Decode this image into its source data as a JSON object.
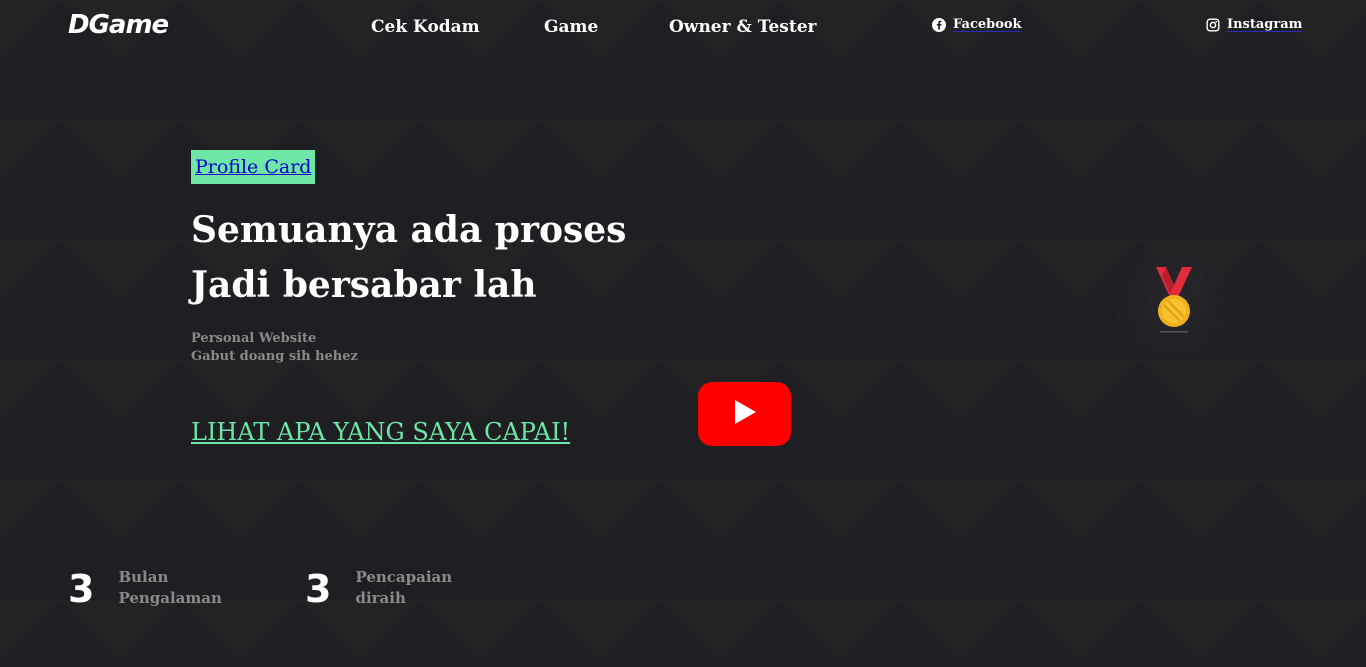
{
  "header": {
    "logo": "DGame",
    "nav": [
      {
        "label": "Cek Kodam"
      },
      {
        "label": "Game"
      },
      {
        "label": "Owner & Tester"
      }
    ],
    "social": [
      {
        "label": "Facebook",
        "icon": "facebook-icon"
      },
      {
        "label": "Instagram",
        "icon": "instagram-icon"
      }
    ]
  },
  "hero": {
    "profile_link": "Profile Card",
    "headline_line1": "Semuanya ada proses",
    "headline_line2": "Jadi bersabar lah",
    "sub_line1": "Personal Website",
    "sub_line2": "Gabut doang sih hehez",
    "cta": "LIHAT APA YANG SAYA CAPAI!"
  },
  "media": {
    "video_icon": "youtube-play-icon",
    "medal_icon": "gold-medal-icon"
  },
  "stats": [
    {
      "number": "3",
      "label_line1": "Bulan",
      "label_line2": "Pengalaman"
    },
    {
      "number": "3",
      "label_line1": "Pencapaian",
      "label_line2": "diraih"
    }
  ],
  "colors": {
    "background": "#1f1f23",
    "accent": "#6ee7a6",
    "link": "#0000cc",
    "youtube": "#ff0000",
    "muted": "#8a8a8a"
  }
}
